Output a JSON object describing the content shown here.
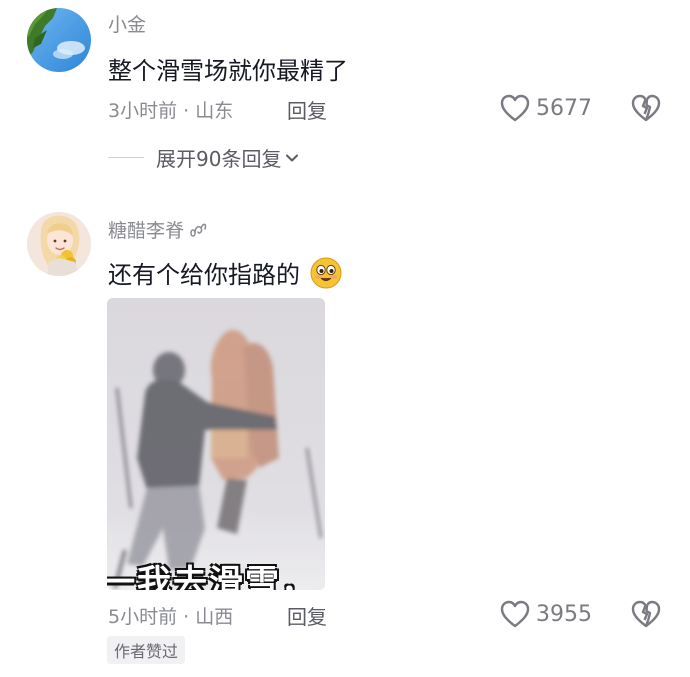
{
  "comments": [
    {
      "username": "小金",
      "text": "整个滑雪场就你最精了",
      "meta": "3小时前 · 山东",
      "reply_label": "回复",
      "likes": "5677",
      "expand_label": "展开90条回复"
    },
    {
      "username": "糖醋李脊",
      "username_icon": "curl-symbol",
      "text": "还有个给你指路的",
      "emoji": "smile-emoji",
      "image_caption": "一我去滑雪，",
      "meta": "5小时前 · 山西",
      "reply_label": "回复",
      "likes": "3955",
      "badge": "作者赞过"
    }
  ],
  "icons": [
    "heart-outline-icon",
    "broken-heart-icon",
    "chevron-down-icon"
  ],
  "colors": {
    "text_primary": "#161823",
    "text_secondary": "#8a8b91",
    "badge_bg": "#f1f1f3"
  }
}
